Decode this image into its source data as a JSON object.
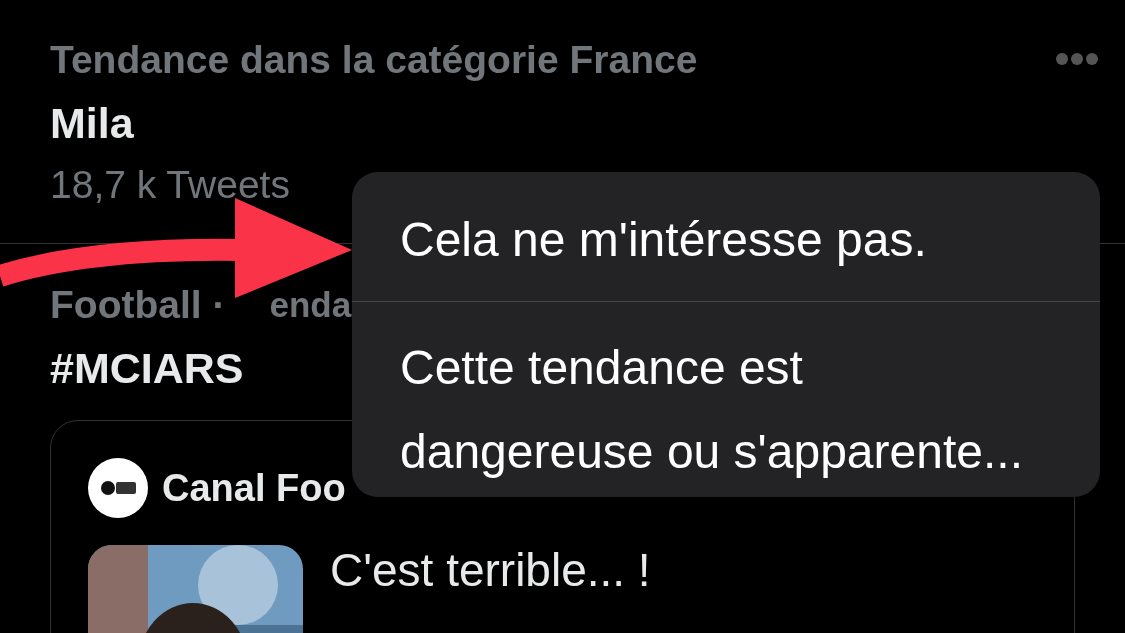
{
  "trends": [
    {
      "category": "Tendance dans la catégorie France",
      "title": "Mila",
      "count": "18,7 k Tweets"
    },
    {
      "category": "Football ·",
      "category_fragment": "enda",
      "title": "#MCIARS"
    }
  ],
  "tweet": {
    "author": "Canal Foo",
    "text": "C'est terrible... !"
  },
  "menu": {
    "items": [
      {
        "label": "Cela ne m'intéresse pas."
      },
      {
        "label": "Cette tendance est dangereuse ou s'apparente..."
      }
    ]
  }
}
